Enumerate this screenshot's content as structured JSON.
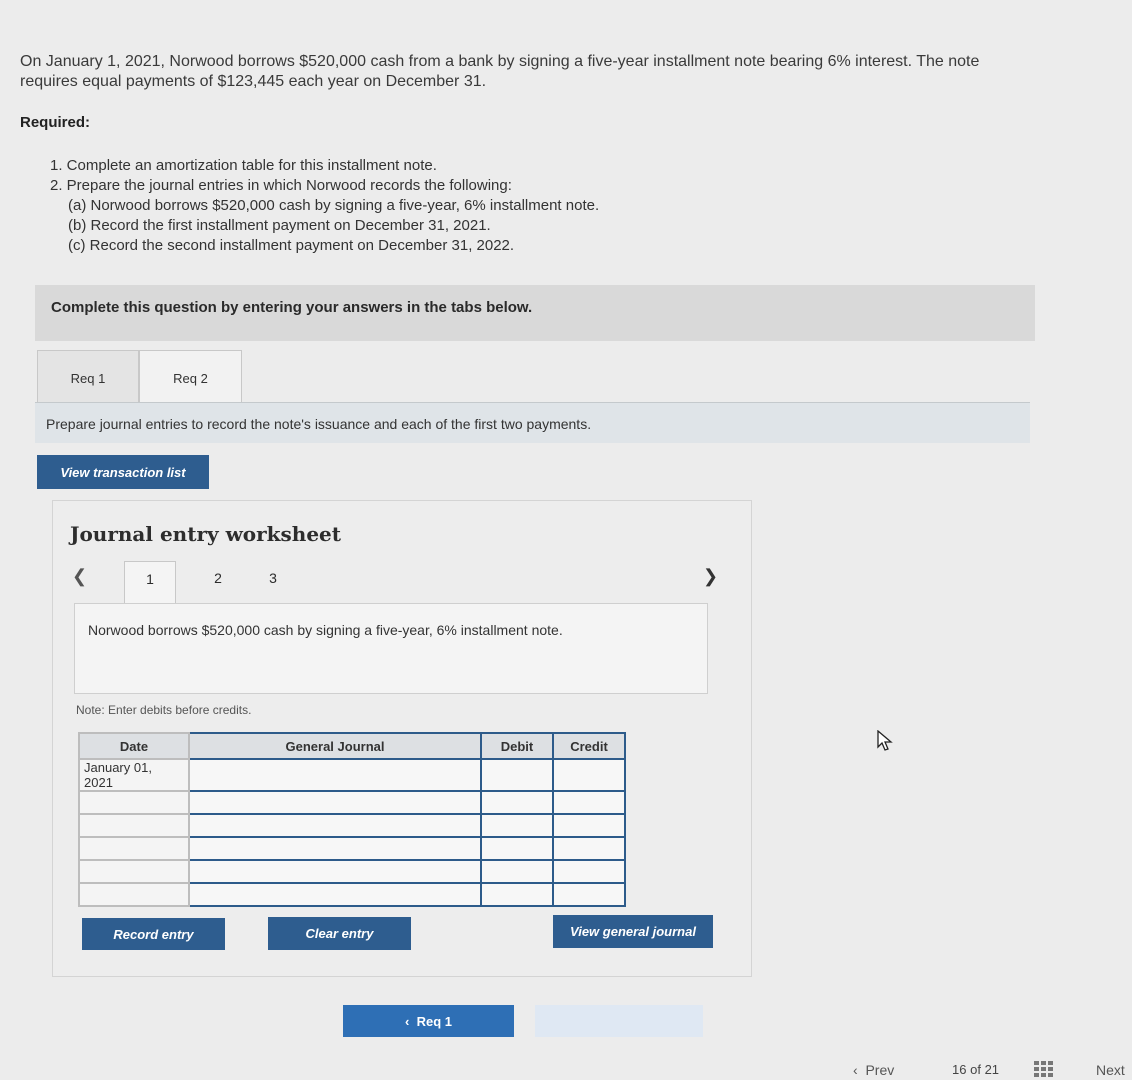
{
  "problem": {
    "text": "On January 1, 2021, Norwood borrows $520,000 cash from a bank by signing a five-year installment note bearing 6% interest. The note requires equal payments of $123,445 each year on December 31.",
    "required_label": "Required:",
    "items": [
      "1. Complete an amortization table for this installment note.",
      "2. Prepare the journal entries in which Norwood records the following:"
    ],
    "subitems": [
      "(a) Norwood borrows $520,000 cash by signing a five-year, 6% installment note.",
      "(b) Record the first installment payment on December 31, 2021.",
      "(c) Record the second installment payment on December 31, 2022."
    ]
  },
  "instruction": "Complete this question by entering your answers in the tabs below.",
  "tabs": [
    {
      "label": "Req 1"
    },
    {
      "label": "Req 2"
    }
  ],
  "prepare_text": "Prepare journal entries to record the note's issuance and each of the first two payments.",
  "buttons": {
    "view_transaction_list": "View transaction list",
    "record_entry": "Record entry",
    "clear_entry": "Clear entry",
    "view_general_journal": "View general journal",
    "req1_nav": "Req 1"
  },
  "worksheet": {
    "title": "Journal entry worksheet",
    "pages": [
      "1",
      "2",
      "3"
    ],
    "description": "Norwood borrows $520,000 cash by signing a five-year, 6% installment note.",
    "note": "Note: Enter debits before credits.",
    "columns": [
      "Date",
      "General Journal",
      "Debit",
      "Credit"
    ],
    "rows": [
      {
        "date": "January 01, 2021",
        "account": "",
        "debit": "",
        "credit": ""
      },
      {
        "date": "",
        "account": "",
        "debit": "",
        "credit": ""
      },
      {
        "date": "",
        "account": "",
        "debit": "",
        "credit": ""
      },
      {
        "date": "",
        "account": "",
        "debit": "",
        "credit": ""
      },
      {
        "date": "",
        "account": "",
        "debit": "",
        "credit": ""
      },
      {
        "date": "",
        "account": "",
        "debit": "",
        "credit": ""
      }
    ]
  },
  "footer": {
    "prev": "Prev",
    "current": "16",
    "of": "of",
    "total": "21",
    "next": "Next"
  },
  "colors": {
    "primary_button": "#2e5d8f",
    "table_border": "#2d5b8a"
  },
  "icons": {
    "left": "chevron-left-icon",
    "right": "chevron-right-icon",
    "cursor": "mouse-cursor-icon",
    "grid": "grid-icon"
  }
}
